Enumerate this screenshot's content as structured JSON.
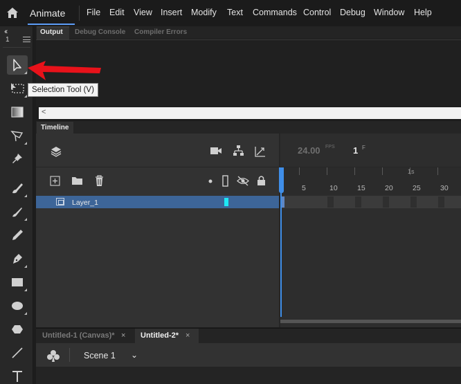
{
  "app": {
    "name": "Animate"
  },
  "menu": [
    "File",
    "Edit",
    "View",
    "Insert",
    "Modify",
    "Text",
    "Commands",
    "Control",
    "Debug",
    "Window",
    "Help"
  ],
  "toolbar": {
    "collapse_glyph": "‹‹",
    "column_count": "1",
    "tools": [
      {
        "icon": "selection-arrow-icon",
        "active": true
      },
      {
        "icon": "free-transform-icon"
      },
      {
        "icon": "gradient-icon"
      },
      {
        "icon": "lasso-icon"
      },
      {
        "icon": "pin-icon"
      },
      {
        "icon": "paint-brush-icon"
      },
      {
        "icon": "brush-icon"
      },
      {
        "icon": "pencil-icon"
      },
      {
        "icon": "pen-icon"
      },
      {
        "icon": "rectangle-icon"
      },
      {
        "icon": "oval-icon"
      },
      {
        "icon": "polystar-icon"
      },
      {
        "icon": "line-icon"
      },
      {
        "icon": "text-icon"
      }
    ]
  },
  "tooltip": {
    "text": "Selection Tool (V)"
  },
  "output_panel": {
    "tabs": [
      "Output",
      "Debug Console",
      "Compiler Errors"
    ],
    "active_tab": "Output",
    "scroll_arrow": "<"
  },
  "timeline": {
    "tab": "Timeline",
    "fps": "24.00",
    "fps_unit": "FPS",
    "frame": "1",
    "frame_unit": "F",
    "second_marker": "1s",
    "ruler_labels": [
      "5",
      "10",
      "15",
      "20",
      "25",
      "30"
    ],
    "layers": [
      {
        "name": "Layer_1",
        "color": "#1ee8f5",
        "selected": true
      }
    ]
  },
  "documents": {
    "tabs": [
      {
        "label": "Untitled-1 (Canvas)*",
        "active": false
      },
      {
        "label": "Untitled-2*",
        "active": true
      }
    ],
    "close_glyph": "×"
  },
  "scene": {
    "label": "Scene 1",
    "chevron": "⌄"
  },
  "colors": {
    "accent": "#3f8ee8",
    "selection": "#3d6598",
    "layer_color": "#1ee8f5",
    "arrow": "#e8121a"
  }
}
